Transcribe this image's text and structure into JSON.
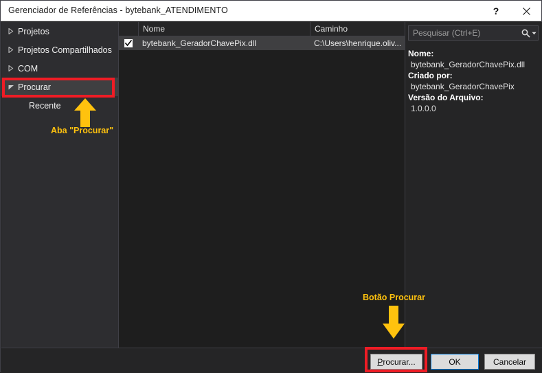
{
  "window": {
    "title": "Gerenciador de Referências - bytebank_ATENDIMENTO",
    "help_icon": "?",
    "close_icon": "close-icon"
  },
  "sidebar": {
    "items": [
      {
        "label": "Projetos",
        "expanded": false,
        "selected": false,
        "child": false
      },
      {
        "label": "Projetos Compartilhados",
        "expanded": false,
        "selected": false,
        "child": false
      },
      {
        "label": "COM",
        "expanded": false,
        "selected": false,
        "child": false
      },
      {
        "label": "Procurar",
        "expanded": true,
        "selected": true,
        "child": false
      },
      {
        "label": "Recente",
        "expanded": false,
        "selected": false,
        "child": true
      }
    ]
  },
  "list": {
    "columns": {
      "check": "",
      "name": "Nome",
      "path": "Caminho"
    },
    "rows": [
      {
        "checked": true,
        "name": "bytebank_GeradorChavePix.dll",
        "path": "C:\\Users\\henrique.oliv..."
      }
    ]
  },
  "search": {
    "placeholder": "Pesquisar (Ctrl+E)",
    "icon": "search-icon",
    "dropdown_icon": "chevron-down-icon"
  },
  "details": {
    "fields": [
      {
        "key": "Nome:",
        "value": "bytebank_GeradorChavePix.dll"
      },
      {
        "key": "Criado por:",
        "value": "bytebank_GeradorChavePix"
      },
      {
        "key": "Versão do Arquivo:",
        "value": "1.0.0.0"
      }
    ]
  },
  "buttons": {
    "browse_accel": "P",
    "browse_rest": "rocurar...",
    "ok": "OK",
    "cancel": "Cancelar"
  },
  "annotations": {
    "tab_label": "Aba \"Procurar\"",
    "button_label": "Botão Procurar",
    "highlight_color": "#ee1c25",
    "arrow_color": "#ffc20e"
  }
}
